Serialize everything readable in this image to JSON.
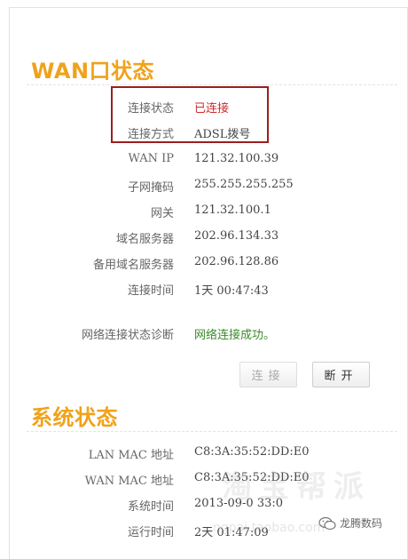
{
  "wan_section": {
    "title": "WAN口状态",
    "rows": [
      {
        "label": "连接状态",
        "value": "已连接"
      },
      {
        "label": "连接方式",
        "value": "ADSL拨号"
      },
      {
        "label": "WAN IP",
        "value": "121.32.100.39"
      },
      {
        "label": "子网掩码",
        "value": "255.255.255.255"
      },
      {
        "label": "网关",
        "value": "121.32.100.1"
      },
      {
        "label": "域名服务器",
        "value": "202.96.134.33"
      },
      {
        "label": "备用域名服务器",
        "value": "202.96.128.86"
      },
      {
        "label": "连接时间",
        "value": "1天 00:47:43"
      }
    ],
    "diagnosis": {
      "label": "网络连接状态诊断",
      "value": "网络连接成功。"
    },
    "buttons": {
      "connect": "连接",
      "disconnect": "断开"
    }
  },
  "system_section": {
    "title": "系统状态",
    "rows": [
      {
        "label": "LAN MAC 地址",
        "value": "C8:3A:35:52:DD:E0"
      },
      {
        "label": "WAN MAC 地址",
        "value": "C8:3A:35:52:DD:E0"
      },
      {
        "label": "系统时间",
        "value": "2013-09-0  33:0"
      },
      {
        "label": "运行时间",
        "value": "2天 01:47:09"
      }
    ]
  },
  "watermark": {
    "text": "淘宝帮派",
    "url": "ngpai.taobao.com",
    "brand": "龙腾数码"
  },
  "colors": {
    "title": "#f0a21a",
    "status_connected": "#cc2d2d",
    "diagnosis_ok": "#3a8a2a",
    "highlight_box": "#9c1e1e"
  },
  "icons": {
    "brand": "wechat-icon"
  }
}
